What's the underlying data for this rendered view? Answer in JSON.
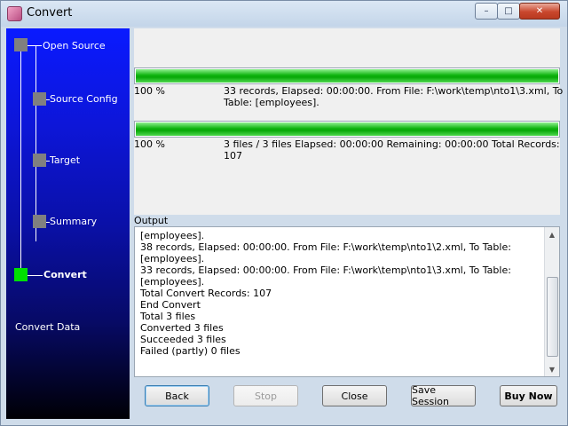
{
  "window": {
    "title": "Convert",
    "app_icon": "app-icon",
    "controls": {
      "minimize": "–",
      "maximize": "□",
      "close": "✕"
    }
  },
  "sidebar": {
    "steps": [
      {
        "label": "Open Source",
        "active": false
      },
      {
        "label": "Source Config",
        "active": false
      },
      {
        "label": "Target",
        "active": false
      },
      {
        "label": "Summary",
        "active": false
      },
      {
        "label": "Convert",
        "active": true
      }
    ],
    "section_label": "Convert Data",
    "colors": {
      "active_box": "#00e000",
      "inactive_box": "#808080"
    }
  },
  "progress": {
    "file_progress": {
      "value": 1.0,
      "percent": "100 %",
      "detail_line1": "33 records,    Elapsed: 00:00:00.    From File: F:\\work\\temp\\nto1\\3.xml,    To",
      "detail_line2": "Table: [employees]."
    },
    "total_progress": {
      "value": 1.0,
      "percent": "100 %",
      "detail_line1": "3 files / 3 files    Elapsed: 00:00:00    Remaining: 00:00:00    Total Records:",
      "detail_line2": "107"
    }
  },
  "output": {
    "label": "Output",
    "lines": [
      "[employees].",
      "38 records,    Elapsed: 00:00:00.    From File: F:\\work\\temp\\nto1\\2.xml,    To Table:",
      "[employees].",
      "33 records,    Elapsed: 00:00:00.    From File: F:\\work\\temp\\nto1\\3.xml,    To Table:",
      "[employees].",
      "Total Convert Records: 107",
      "End Convert",
      "Total 3 files",
      "Converted 3 files",
      "Succeeded 3 files",
      "Failed (partly) 0 files"
    ]
  },
  "buttons": {
    "back": "Back",
    "stop": "Stop",
    "close": "Close",
    "save_session": "Save Session",
    "buy_now": "Buy Now"
  }
}
